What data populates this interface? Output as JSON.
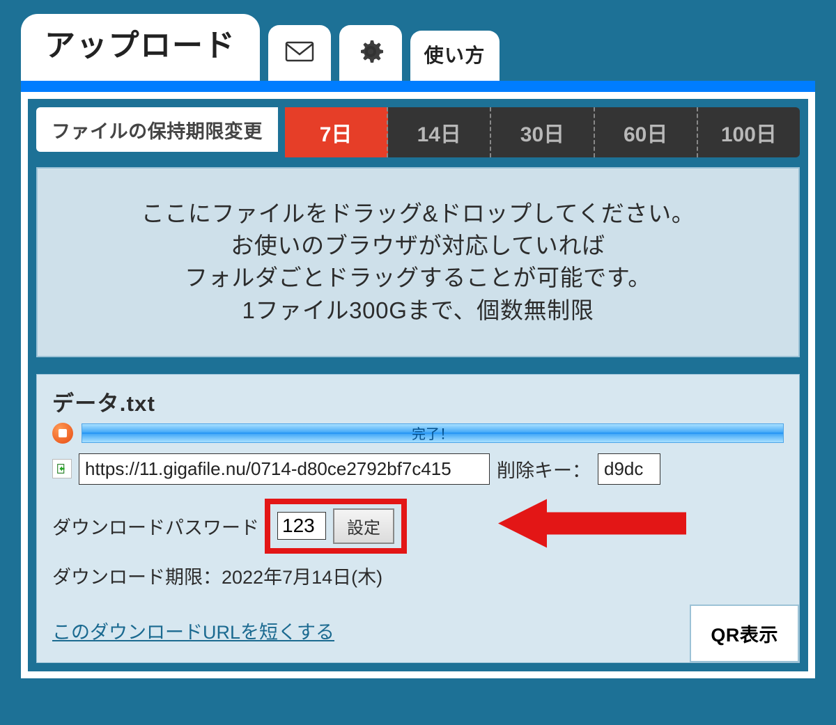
{
  "tabs": {
    "upload": "アップロード",
    "howto": "使い方"
  },
  "retention": {
    "label": "ファイルの保持期限変更",
    "options": [
      "7日",
      "14日",
      "30日",
      "60日",
      "100日"
    ],
    "active_index": 0
  },
  "dropzone": {
    "line1": "ここにファイルをドラッグ&ドロップしてください。",
    "line2": "お使いのブラウザが対応していれば",
    "line3": "フォルダごとドラッグすることが可能です。",
    "line4": "1ファイル300Gまで、個数無制限"
  },
  "result": {
    "filename": "データ.txt",
    "progress_text": "完了！",
    "url": "https://11.gigafile.nu/0714-d80ce2792bf7c415",
    "delete_key_label": "削除キー：",
    "delete_key": "d9dc",
    "password_label": "ダウンロードパスワード",
    "password_value": "123",
    "password_set_btn": "設定",
    "deadline_label": "ダウンロード期限：",
    "deadline_value": "2022年7月14日(木)",
    "shorten_link": "このダウンロードURLを短くする",
    "qr_button": "QR表示"
  }
}
